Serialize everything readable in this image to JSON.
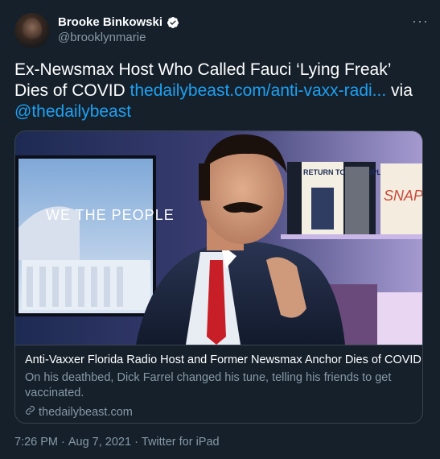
{
  "author": {
    "display_name": "Brooke Binkowski",
    "handle": "@brooklynmarie",
    "verified": true
  },
  "tweet": {
    "text": "Ex-Newsmax Host Who Called Fauci ‘Lying Freak’ Dies of COVID",
    "link": "thedailybeast.com/anti-vaxx-radi...",
    "via_word": "via",
    "mention": "@thedailybeast"
  },
  "card": {
    "image_caption_text": "WE THE PEOPLE",
    "title": "Anti-Vaxxer Florida Radio Host and Former Newsmax Anchor Dies of COVID",
    "description": "On his deathbed, Dick Farrel changed his tune, telling his friends to get vaccinated.",
    "domain": "thedailybeast.com",
    "book_1": "RETURN TO PRINCIPLE",
    "book_2": "SNAP"
  },
  "meta": {
    "time": "7:26 PM",
    "date": "Aug 7, 2021",
    "source": "Twitter for iPad",
    "separator": "·"
  },
  "colors": {
    "background": "#15202b",
    "secondary_text": "#8899a6",
    "link": "#1da1f2",
    "border": "#38444d",
    "verified": "#ffffff"
  }
}
